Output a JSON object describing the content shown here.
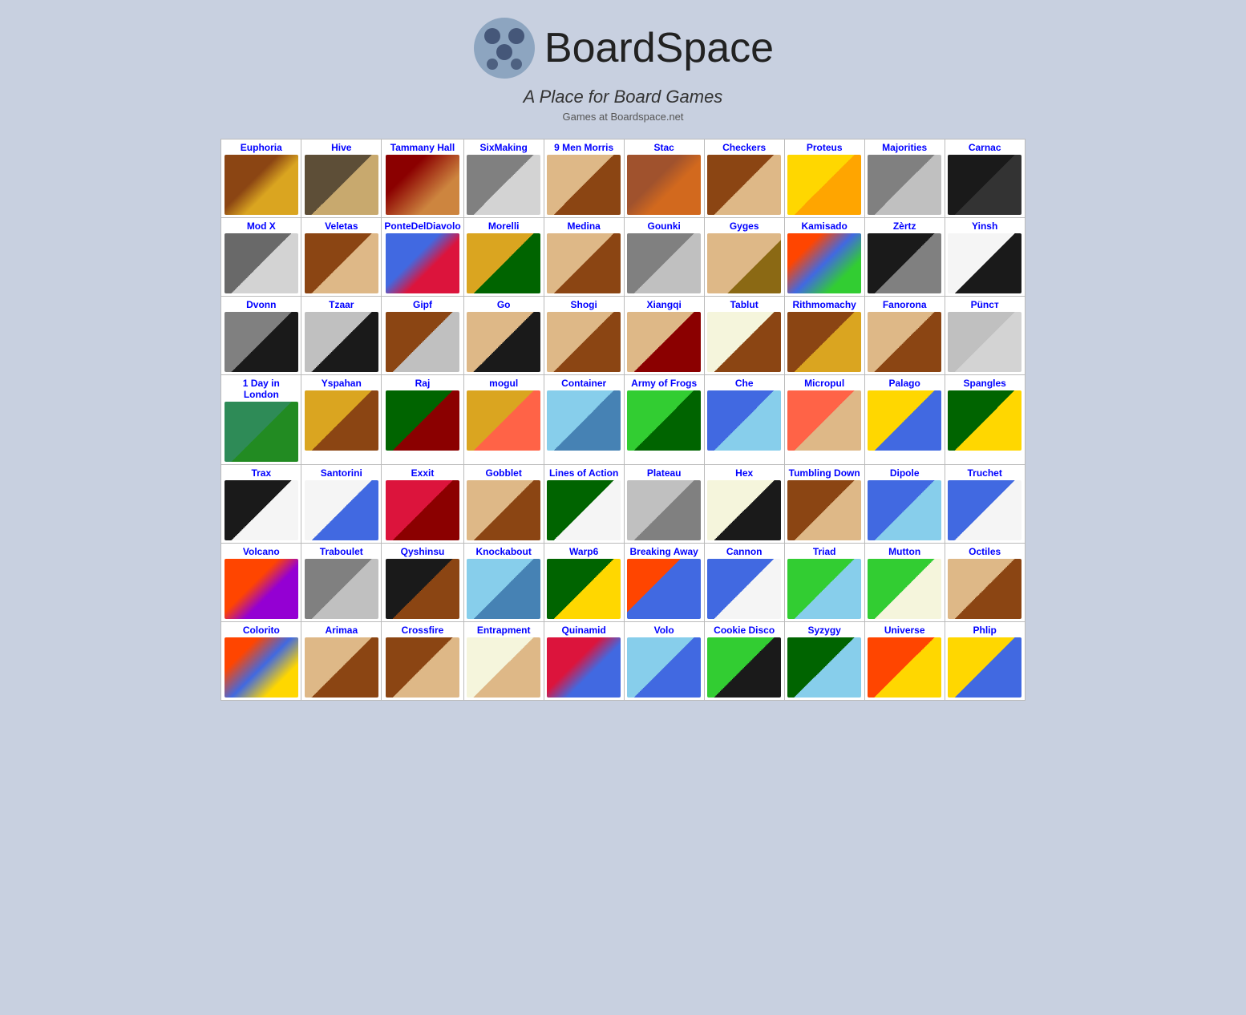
{
  "header": {
    "site_title": "BoardSpace",
    "tagline": "A Place for Board Games",
    "games_label": "Games at Boardspace.net"
  },
  "games": [
    [
      {
        "name": "Euphoria",
        "thumb_class": "thumb-euphoria"
      },
      {
        "name": "Hive",
        "thumb_class": "thumb-hive"
      },
      {
        "name": "Tammany Hall",
        "thumb_class": "thumb-tammany"
      },
      {
        "name": "SixMaking",
        "thumb_class": "thumb-sixmaking"
      },
      {
        "name": "9 Men Morris",
        "thumb_class": "thumb-9men"
      },
      {
        "name": "Stac",
        "thumb_class": "thumb-stac"
      },
      {
        "name": "Checkers",
        "thumb_class": "thumb-checkers"
      },
      {
        "name": "Proteus",
        "thumb_class": "thumb-proteus"
      },
      {
        "name": "Majorities",
        "thumb_class": "thumb-majorities"
      },
      {
        "name": "Carnac",
        "thumb_class": "thumb-carnac"
      }
    ],
    [
      {
        "name": "Mod X",
        "thumb_class": "thumb-modx"
      },
      {
        "name": "Veletas",
        "thumb_class": "thumb-veletas"
      },
      {
        "name": "PonteDelDiavolo",
        "thumb_class": "thumb-ponte"
      },
      {
        "name": "Morelli",
        "thumb_class": "thumb-morelli"
      },
      {
        "name": "Medina",
        "thumb_class": "thumb-medina"
      },
      {
        "name": "Gounki",
        "thumb_class": "thumb-gounki"
      },
      {
        "name": "Gyges",
        "thumb_class": "thumb-gyges"
      },
      {
        "name": "Kamisado",
        "thumb_class": "thumb-kamisado"
      },
      {
        "name": "Zèrtz",
        "thumb_class": "thumb-zertz"
      },
      {
        "name": "Yinsh",
        "thumb_class": "thumb-yinsh"
      }
    ],
    [
      {
        "name": "Dvonn",
        "thumb_class": "thumb-dvonn"
      },
      {
        "name": "Tzaar",
        "thumb_class": "thumb-tzaar"
      },
      {
        "name": "Gipf",
        "thumb_class": "thumb-gipf"
      },
      {
        "name": "Go",
        "thumb_class": "thumb-go"
      },
      {
        "name": "Shogi",
        "thumb_class": "thumb-shogi"
      },
      {
        "name": "Xiangqi",
        "thumb_class": "thumb-xiangqi"
      },
      {
        "name": "Tablut",
        "thumb_class": "thumb-tablut"
      },
      {
        "name": "Rithmomachy",
        "thumb_class": "thumb-rithmo"
      },
      {
        "name": "Fanorona",
        "thumb_class": "thumb-fanorona"
      },
      {
        "name": "Püncт",
        "thumb_class": "thumb-punct"
      }
    ],
    [
      {
        "name": "1 Day in London",
        "thumb_class": "thumb-london"
      },
      {
        "name": "Yspahan",
        "thumb_class": "thumb-yspahan"
      },
      {
        "name": "Raj",
        "thumb_class": "thumb-raj"
      },
      {
        "name": "mogul",
        "thumb_class": "thumb-mogul"
      },
      {
        "name": "Container",
        "thumb_class": "thumb-container"
      },
      {
        "name": "Army of Frogs",
        "thumb_class": "thumb-armyfrogs"
      },
      {
        "name": "Che",
        "thumb_class": "thumb-che"
      },
      {
        "name": "Micropul",
        "thumb_class": "thumb-micropul"
      },
      {
        "name": "Palago",
        "thumb_class": "thumb-palago"
      },
      {
        "name": "Spangles",
        "thumb_class": "thumb-spangles"
      }
    ],
    [
      {
        "name": "Trax",
        "thumb_class": "thumb-trax"
      },
      {
        "name": "Santorini",
        "thumb_class": "thumb-santorini"
      },
      {
        "name": "Exxit",
        "thumb_class": "thumb-exxit"
      },
      {
        "name": "Gobblet",
        "thumb_class": "thumb-gobblet"
      },
      {
        "name": "Lines of Action",
        "thumb_class": "thumb-loa"
      },
      {
        "name": "Plateau",
        "thumb_class": "thumb-plateau"
      },
      {
        "name": "Hex",
        "thumb_class": "thumb-hex"
      },
      {
        "name": "Tumbling Down",
        "thumb_class": "thumb-tumbling"
      },
      {
        "name": "Dipole",
        "thumb_class": "thumb-dipole"
      },
      {
        "name": "Truchet",
        "thumb_class": "thumb-truchet"
      }
    ],
    [
      {
        "name": "Volcano",
        "thumb_class": "thumb-volcano"
      },
      {
        "name": "Traboulet",
        "thumb_class": "thumb-traboulet"
      },
      {
        "name": "Qyshinsu",
        "thumb_class": "thumb-qyshinsu"
      },
      {
        "name": "Knockabout",
        "thumb_class": "thumb-knockabout"
      },
      {
        "name": "Warp6",
        "thumb_class": "thumb-warp6"
      },
      {
        "name": "Breaking Away",
        "thumb_class": "thumb-breaking"
      },
      {
        "name": "Cannon",
        "thumb_class": "thumb-cannon"
      },
      {
        "name": "Triad",
        "thumb_class": "thumb-triad"
      },
      {
        "name": "Mutton",
        "thumb_class": "thumb-mutton"
      },
      {
        "name": "Octiles",
        "thumb_class": "thumb-octiles"
      }
    ],
    [
      {
        "name": "Colorito",
        "thumb_class": "thumb-colorito"
      },
      {
        "name": "Arimaa",
        "thumb_class": "thumb-arimaa"
      },
      {
        "name": "Crossfire",
        "thumb_class": "thumb-crossfire"
      },
      {
        "name": "Entrapment",
        "thumb_class": "thumb-entrapment"
      },
      {
        "name": "Quinamid",
        "thumb_class": "thumb-quinamid"
      },
      {
        "name": "Volo",
        "thumb_class": "thumb-volo"
      },
      {
        "name": "Cookie Disco",
        "thumb_class": "thumb-cookie"
      },
      {
        "name": "Syzygy",
        "thumb_class": "thumb-syzygy"
      },
      {
        "name": "Universe",
        "thumb_class": "thumb-universe"
      },
      {
        "name": "Phlip",
        "thumb_class": "thumb-phlip"
      }
    ]
  ]
}
